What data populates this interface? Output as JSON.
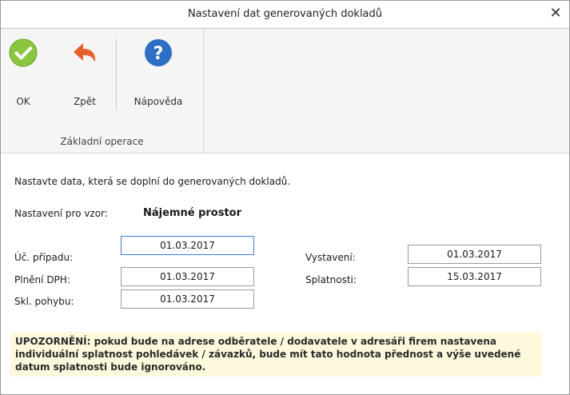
{
  "window": {
    "title": "Nastavení dat generovaných dokladů",
    "close_glyph": "✕"
  },
  "ribbon": {
    "buttons": [
      {
        "label": "OK",
        "icon": "ok-check-icon",
        "color": "#8cc63e"
      },
      {
        "label": "Zpět",
        "icon": "undo-arrow-icon",
        "color": "#e8612b"
      },
      {
        "label": "Nápověda",
        "icon": "help-question-icon",
        "color": "#2d6fc4"
      }
    ],
    "group_label": "Základní operace"
  },
  "content": {
    "intro": "Nastavte data, která se doplní do generovaných dokladů.",
    "pattern_label": "Nastavení pro vzor:",
    "pattern_value": "Nájemné prostor",
    "fields_left": [
      {
        "label": "Úč. případu:",
        "value": "01.03.2017"
      },
      {
        "label": "Plnění DPH:",
        "value": "01.03.2017"
      },
      {
        "label": "Skl. pohybu:",
        "value": "01.03.2017"
      }
    ],
    "fields_right": [
      {
        "label": "Vystavení:",
        "value": "01.03.2017"
      },
      {
        "label": "Splatnosti:",
        "value": "15.03.2017"
      }
    ],
    "warning": "UPOZORNĚNÍ: pokud bude na adrese odběratele / dodavatele v adresáři firem nastavena individuální splatnost pohledávek / závazků, bude mít tato hodnota přednost a výše uvedené datum splatnosti bude ignorováno."
  },
  "colors": {
    "ribbon_bg": "#f5f5f5",
    "warning_bg": "#fdf9dc",
    "focus_border": "#3c7bd4"
  }
}
